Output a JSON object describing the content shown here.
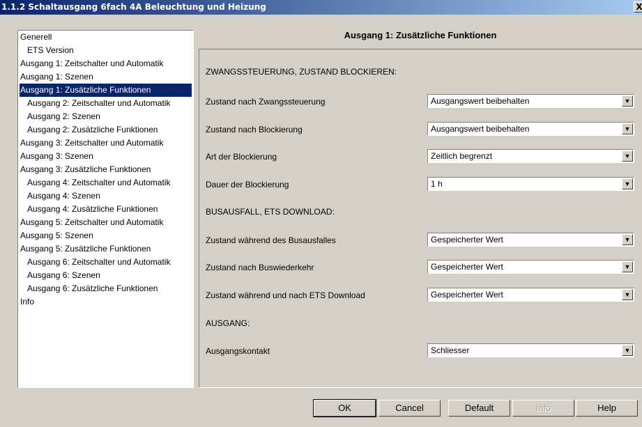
{
  "window": {
    "title": "1.1.2 Schaltausgang 6fach 4A Beleuchtung und Heizung",
    "close_glyph": "X"
  },
  "tree": {
    "items": [
      {
        "label": "Generell",
        "indent": false,
        "selected": false
      },
      {
        "label": "ETS Version",
        "indent": true,
        "selected": false
      },
      {
        "label": "Ausgang 1: Zeitschalter und Automatik",
        "indent": false,
        "selected": false
      },
      {
        "label": "Ausgang 1: Szenen",
        "indent": false,
        "selected": false
      },
      {
        "label": "Ausgang 1: Zusätzliche Funktionen",
        "indent": false,
        "selected": true
      },
      {
        "label": "Ausgang 2: Zeitschalter und Automatik",
        "indent": true,
        "selected": false
      },
      {
        "label": "Ausgang 2: Szenen",
        "indent": true,
        "selected": false
      },
      {
        "label": "Ausgang 2: Zusätzliche Funktionen",
        "indent": true,
        "selected": false
      },
      {
        "label": "Ausgang 3: Zeitschalter und Automatik",
        "indent": false,
        "selected": false
      },
      {
        "label": "Ausgang 3: Szenen",
        "indent": false,
        "selected": false
      },
      {
        "label": "Ausgang 3: Zusätzliche Funktionen",
        "indent": false,
        "selected": false
      },
      {
        "label": "Ausgang 4: Zeitschalter und Automatik",
        "indent": true,
        "selected": false
      },
      {
        "label": "Ausgang 4: Szenen",
        "indent": true,
        "selected": false
      },
      {
        "label": "Ausgang 4: Zusätzliche Funktionen",
        "indent": true,
        "selected": false
      },
      {
        "label": "Ausgang 5: Zeitschalter und Automatik",
        "indent": false,
        "selected": false
      },
      {
        "label": "Ausgang 5: Szenen",
        "indent": false,
        "selected": false
      },
      {
        "label": "Ausgang 5: Zusätzliche Funktionen",
        "indent": false,
        "selected": false
      },
      {
        "label": "Ausgang 6: Zeitschalter und Automatik",
        "indent": true,
        "selected": false
      },
      {
        "label": "Ausgang 6: Szenen",
        "indent": true,
        "selected": false
      },
      {
        "label": "Ausgang 6: Zusätzliche Funktionen",
        "indent": true,
        "selected": false
      },
      {
        "label": "Info",
        "indent": false,
        "selected": false
      }
    ]
  },
  "panel": {
    "title": "Ausgang 1: Zusätzliche Funktionen",
    "sections": {
      "forced": "ZWANGSSTEUERUNG, ZUSTAND BLOCKIEREN:",
      "bus": "BUSAUSFALL, ETS DOWNLOAD:",
      "output": "AUSGANG:"
    },
    "params": [
      {
        "label": "Zustand nach Zwangssteuerung",
        "value": "Ausgangswert beibehalten"
      },
      {
        "label": "Zustand nach Blockierung",
        "value": "Ausgangswert beibehalten"
      },
      {
        "label": "Art der Blockierung",
        "value": "Zeitlich begrenzt"
      },
      {
        "label": "Dauer der Blockierung",
        "value": "1 h"
      },
      {
        "label": "Zustand während des Busausfalles",
        "value": "Gespeicherter Wert"
      },
      {
        "label": "Zustand nach Buswiederkehr",
        "value": "Gespeicherter Wert"
      },
      {
        "label": "Zustand während und nach ETS Download",
        "value": "Gespeicherter Wert"
      },
      {
        "label": "Ausgangskontakt",
        "value": "Schliesser"
      }
    ]
  },
  "buttons": {
    "ok": "OK",
    "cancel": "Cancel",
    "default": "Default",
    "info": "Info",
    "help": "Help"
  },
  "icons": {
    "dropdown": "chevron-down-icon",
    "close": "close-icon"
  }
}
